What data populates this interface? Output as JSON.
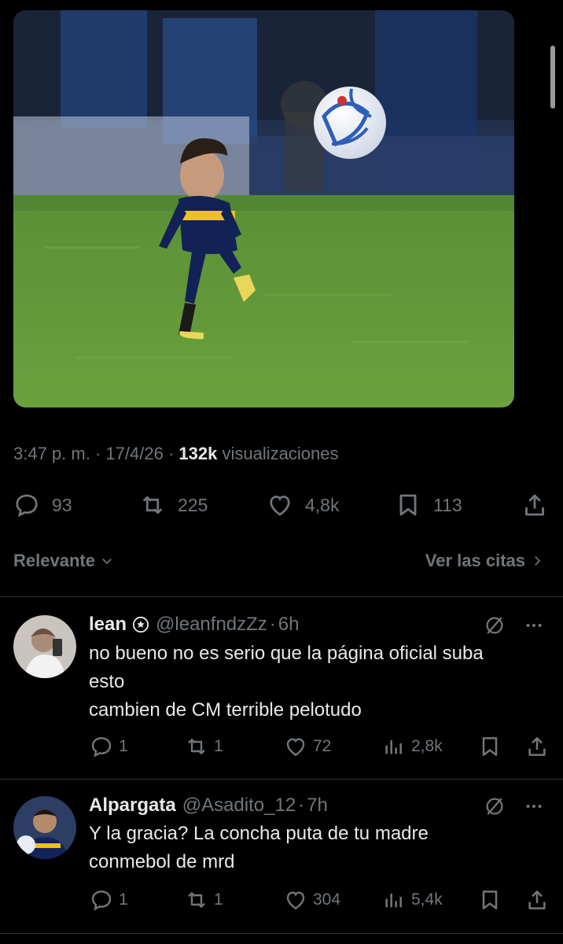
{
  "colors": {
    "background": "#000000",
    "text": "#e7e9ea",
    "secondary": "#71767b",
    "divider": "#2f3336"
  },
  "post": {
    "media_alt": "soccer-player-kicking-ball-photo",
    "time": "3:47 p. m.",
    "date": "17/4/26",
    "views_count": "132k",
    "views_label": "visualizaciones",
    "separator": "·",
    "actions": {
      "replies": "93",
      "reposts": "225",
      "likes": "4,8k",
      "bookmarks": "113"
    }
  },
  "sort": {
    "label": "Relevante",
    "quotes_label": "Ver las citas"
  },
  "replies": [
    {
      "name": "lean",
      "handle": "@leanfndzZz",
      "time": "6h",
      "lines": [
        "no bueno no es serio que la página oficial suba",
        "esto",
        "cambien de CM terrible pelotudo"
      ],
      "stats": {
        "replies": "1",
        "reposts": "1",
        "likes": "72",
        "views": "2,8k"
      }
    },
    {
      "name": "Alpargata",
      "handle": "@Asadito_12",
      "time": "7h",
      "lines": [
        "Y la gracia? La concha puta de tu madre",
        "conmebol de mrd"
      ],
      "stats": {
        "replies": "1",
        "reposts": "1",
        "likes": "304",
        "views": "5,4k"
      }
    }
  ]
}
